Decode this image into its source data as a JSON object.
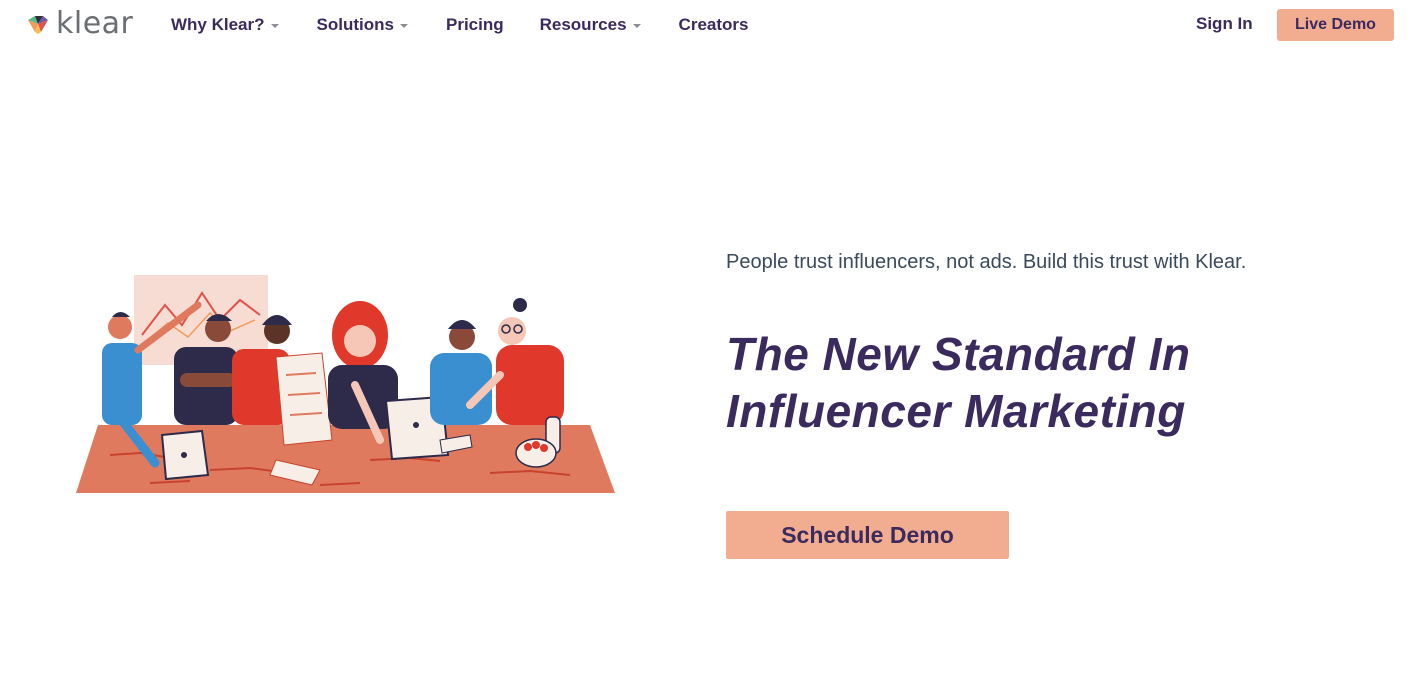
{
  "brand": {
    "name": "klear",
    "colors": {
      "accent": "#f2ad90",
      "primary_text": "#3b2a5e",
      "body_text": "#3a4a5c",
      "logo_text": "#6b6f73"
    }
  },
  "nav": {
    "items": [
      {
        "label": "Why Klear?",
        "has_dropdown": true
      },
      {
        "label": "Solutions",
        "has_dropdown": true
      },
      {
        "label": "Pricing",
        "has_dropdown": false
      },
      {
        "label": "Resources",
        "has_dropdown": true
      },
      {
        "label": "Creators",
        "has_dropdown": false
      }
    ],
    "sign_in": "Sign In",
    "live_demo": "Live Demo"
  },
  "hero": {
    "tagline": "People trust influencers, not ads. Build this trust with Klear.",
    "headline_line1": "The New Standard In",
    "headline_line2": "Influencer Marketing",
    "cta": "Schedule Demo"
  },
  "icons": {
    "logo_mark": "klear-gem-logo-icon",
    "dropdown": "caret-down-icon",
    "illustration": "team-meeting-illustration"
  }
}
